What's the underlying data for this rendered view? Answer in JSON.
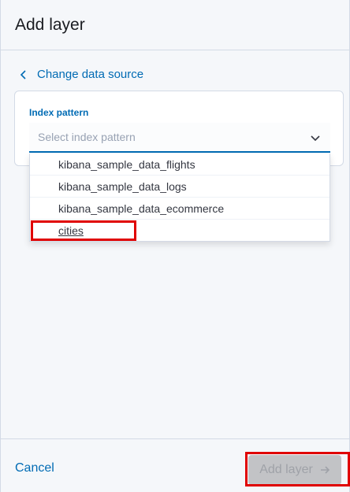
{
  "header": {
    "title": "Add layer"
  },
  "back_link": {
    "label": "Change data source",
    "icon": "chevron-left-icon"
  },
  "form": {
    "field_label": "Index pattern",
    "placeholder": "Select index pattern",
    "chevron_icon": "chevron-down-icon"
  },
  "dropdown": {
    "options": [
      "kibana_sample_data_flights",
      "kibana_sample_data_logs",
      "kibana_sample_data_ecommerce",
      "cities"
    ]
  },
  "footer": {
    "cancel_label": "Cancel",
    "add_label": "Add layer",
    "add_icon": "arrow-right-icon"
  },
  "colors": {
    "accent": "#006bb4",
    "highlight": "#e00000",
    "disabled_bg": "#c2c3c6"
  }
}
